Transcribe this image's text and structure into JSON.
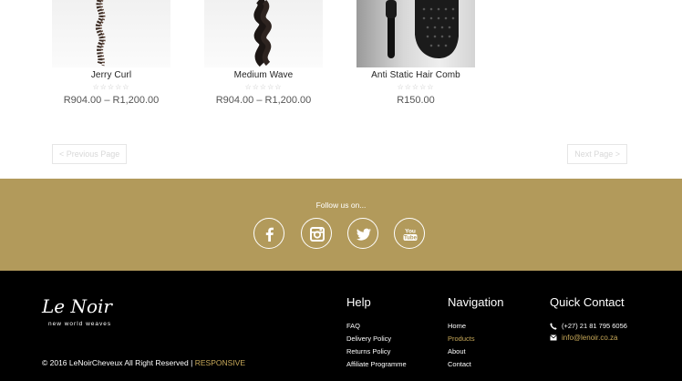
{
  "products": [
    {
      "title": "Jerry Curl",
      "stars": "☆☆☆☆☆",
      "price": "R904.00 – R1,200.00"
    },
    {
      "title": "Medium Wave",
      "stars": "☆☆☆☆☆",
      "price": "R904.00 – R1,200.00"
    },
    {
      "title": "Anti Static Hair Comb",
      "stars": "☆☆☆☆☆",
      "price": "R150.00"
    }
  ],
  "pagination": {
    "prev": "< Previous Page",
    "next": "Next Page >"
  },
  "follow": {
    "label": "Follow us on...",
    "icons": [
      "facebook-icon",
      "instagram-icon",
      "twitter-icon",
      "youtube-icon"
    ]
  },
  "footer": {
    "logo_text": "Le Noir",
    "logo_tagline": "new world weaves",
    "copyright": "© 2016 LeNoirCheveux All Right Reserved |",
    "copyright_link": "RESPONSIVE",
    "help": {
      "title": "Help",
      "links": [
        "FAQ",
        "Delivery Policy",
        "Returns Policy",
        "Affiliate Programme"
      ]
    },
    "navigation": {
      "title": "Navigation",
      "links": [
        "Home",
        "Products",
        "About",
        "Contact"
      ],
      "active": "Products"
    },
    "quick_contact": {
      "title": "Quick Contact",
      "phone": "(+27) 21 81 795 6056",
      "email": "info@lenoir.co.za"
    }
  },
  "colors": {
    "accent_gold": "#b29a5b",
    "link_gold": "#c8a959",
    "footer_bg": "#000000"
  }
}
